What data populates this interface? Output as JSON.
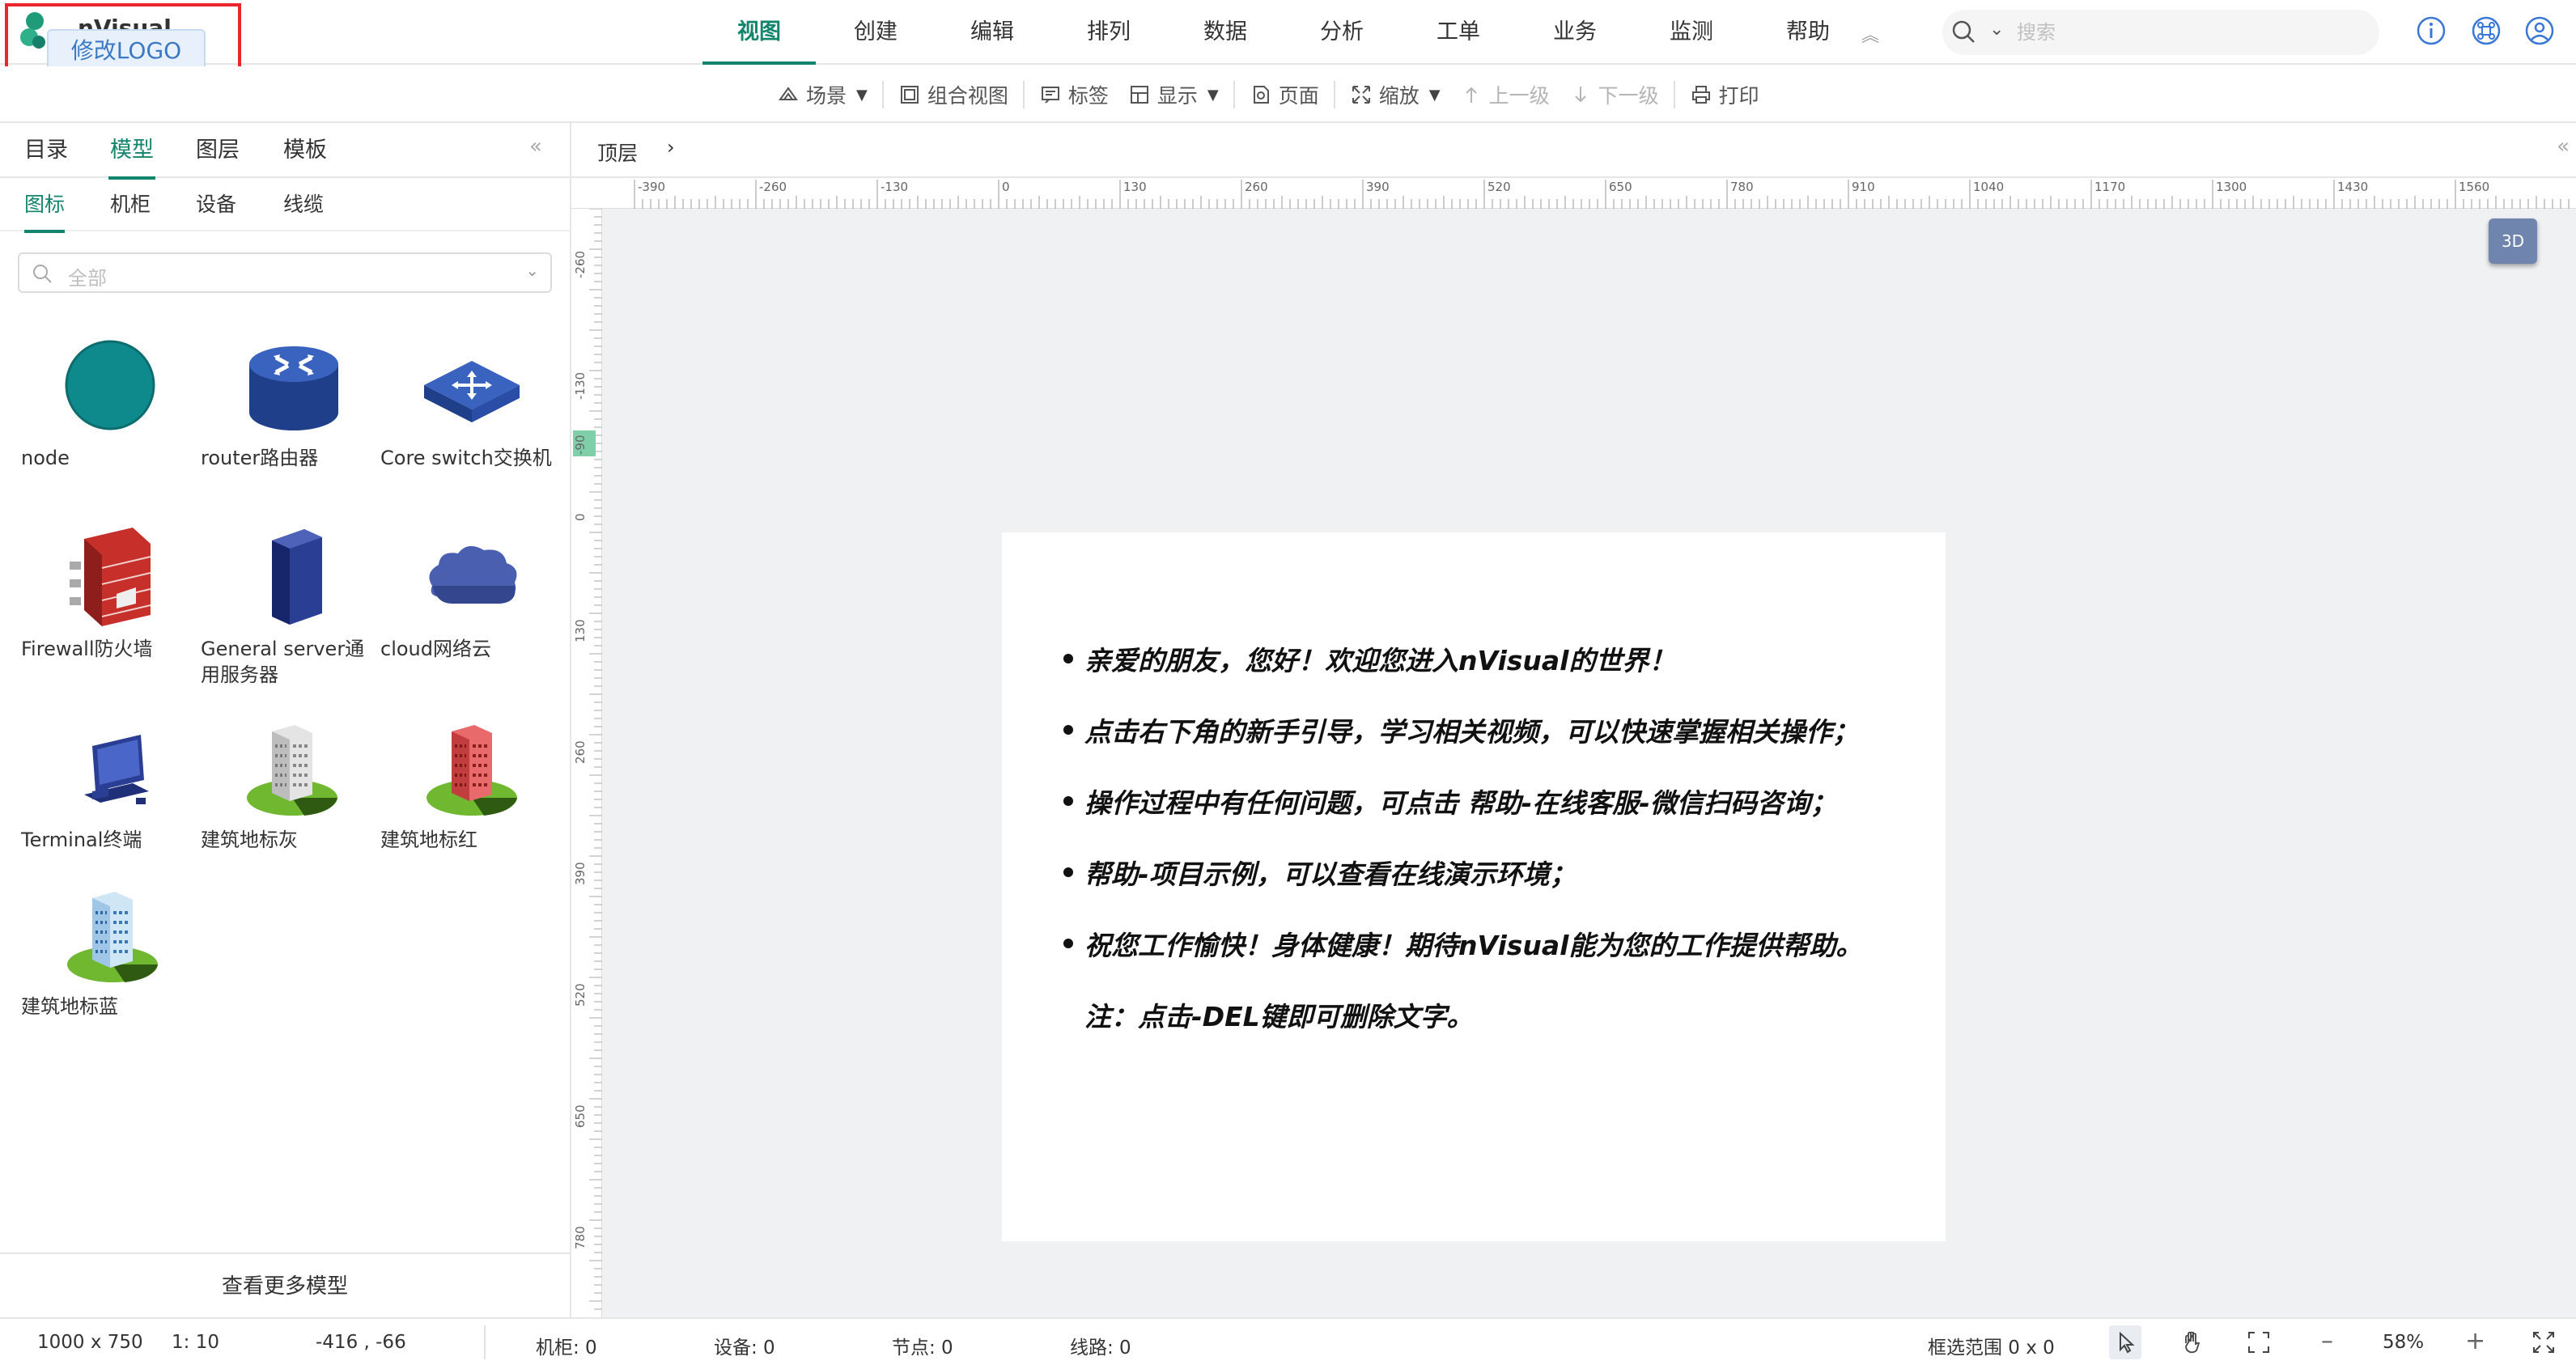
{
  "app": {
    "logo_text": "nVisual",
    "logo_button": "修改LOGO",
    "brand_color": "#14856d"
  },
  "main_menu": [
    {
      "label": "视图",
      "active": true
    },
    {
      "label": "创建"
    },
    {
      "label": "编辑"
    },
    {
      "label": "排列"
    },
    {
      "label": "数据"
    },
    {
      "label": "分析"
    },
    {
      "label": "工单"
    },
    {
      "label": "业务"
    },
    {
      "label": "监测"
    },
    {
      "label": "帮助"
    }
  ],
  "search": {
    "placeholder": "搜索",
    "icon": "search-icon"
  },
  "top_icons": [
    "info-icon",
    "command-icon",
    "user-icon"
  ],
  "toolbar": [
    {
      "label": "场景",
      "icon": "scene-icon",
      "dropdown": true
    },
    {
      "label": "组合视图",
      "icon": "combined-view-icon"
    },
    {
      "label": "标签",
      "icon": "label-icon"
    },
    {
      "label": "显示",
      "icon": "display-icon",
      "dropdown": true
    },
    {
      "label": "页面",
      "icon": "page-icon"
    },
    {
      "label": "缩放",
      "icon": "zoom-icon",
      "dropdown": true
    },
    {
      "label": "上一级",
      "icon": "level-up-icon",
      "disabled": true
    },
    {
      "label": "下一级",
      "icon": "level-down-icon",
      "disabled": true
    },
    {
      "label": "打印",
      "icon": "print-icon"
    }
  ],
  "left_panel": {
    "tabs": [
      "目录",
      "模型",
      "图层",
      "模板"
    ],
    "active_tab": "模型",
    "subtabs": [
      "图标",
      "机柜",
      "设备",
      "线缆"
    ],
    "active_subtab": "图标",
    "filter_value": "全部",
    "models": [
      {
        "label": "node",
        "icon": "node-icon"
      },
      {
        "label": "router路由器",
        "icon": "router-icon"
      },
      {
        "label": "Core switch交换机",
        "icon": "core-switch-icon"
      },
      {
        "label": "Firewall防火墙",
        "icon": "firewall-icon"
      },
      {
        "label": "General server通用服务器",
        "icon": "server-icon"
      },
      {
        "label": "cloud网络云",
        "icon": "cloud-icon"
      },
      {
        "label": "Terminal终端",
        "icon": "terminal-icon"
      },
      {
        "label": "建筑地标灰",
        "icon": "building-gray-icon"
      },
      {
        "label": "建筑地标红",
        "icon": "building-red-icon"
      },
      {
        "label": "建筑地标蓝",
        "icon": "building-blue-icon"
      }
    ],
    "more_button": "查看更多模型"
  },
  "canvas": {
    "breadcrumb": "顶层",
    "btn_3d": "3D",
    "ruler_top": [
      "-390",
      "-260",
      "-130",
      "0",
      "130",
      "260",
      "390",
      "520",
      "650",
      "780",
      "910",
      "1040",
      "1170",
      "1300",
      "1430",
      "1560"
    ],
    "ruler_left": [
      "-260",
      "-130",
      "-90",
      "0",
      "130",
      "260",
      "390",
      "520",
      "650",
      "780"
    ],
    "note_lines": [
      {
        "text": "亲爱的朋友，您好！欢迎您进入nVisual的世界！",
        "bullet": true
      },
      {
        "text": "点击右下角的新手引导，学习相关视频，可以快速掌握相关操作；",
        "bullet": true
      },
      {
        "text": "操作过程中有任何问题，可点击 帮助-在线客服-微信扫码咨询；",
        "bullet": true
      },
      {
        "text": "帮助-项目示例，可以查看在线演示环境；",
        "bullet": true
      },
      {
        "text": "祝您工作愉快！身体健康！期待nVisual能为您的工作提供帮助。",
        "bullet": true
      },
      {
        "text": "注：点击-DEL键即可删除文字。",
        "bullet": false
      }
    ]
  },
  "status": {
    "page_size": "1000 x 750",
    "scale": "1: 10",
    "coords": "-416 , -66",
    "racks": "机柜: 0",
    "devices": "设备: 0",
    "nodes": "节点: 0",
    "lines": "线路: 0",
    "selection": "框选范围  0 x 0",
    "zoom": "58%"
  }
}
